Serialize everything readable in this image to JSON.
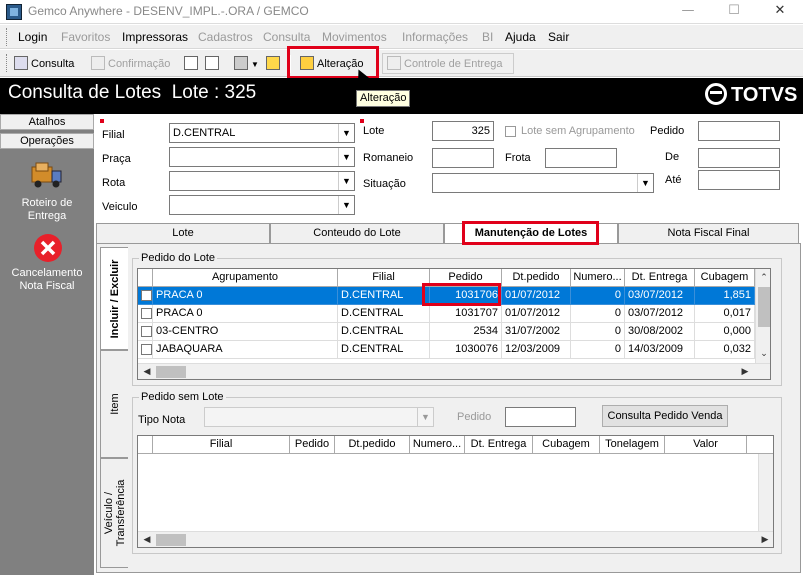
{
  "window": {
    "title": "Gemco Anywhere - DESENV_IMPL.-.ORA / GEMCO"
  },
  "menubar": {
    "items": [
      {
        "label": "Login",
        "enabled": true
      },
      {
        "label": "Favoritos",
        "enabled": false
      },
      {
        "label": "Impressoras",
        "enabled": true
      },
      {
        "label": "Cadastros",
        "enabled": false
      },
      {
        "label": "Consulta",
        "enabled": false
      },
      {
        "label": "Movimentos",
        "enabled": false
      },
      {
        "label": "Informações",
        "enabled": false
      },
      {
        "label": "BI",
        "enabled": false
      },
      {
        "label": "Ajuda",
        "enabled": true
      },
      {
        "label": "Sair",
        "enabled": true
      }
    ]
  },
  "toolbar": {
    "consulta": "Consulta",
    "confirmacao": "Confirmação",
    "alteracao": "Alteração",
    "controle_entrega": "Controle de Entrega"
  },
  "tooltip": "Alteração",
  "header": {
    "title": "Consulta de Lotes  Lote : 325",
    "brand": "TOTVS"
  },
  "sidebar": {
    "atalhos": "Atalhos",
    "operacoes": "Operações",
    "items": [
      {
        "label": "Roteiro de Entrega",
        "icon": "truck-icon"
      },
      {
        "label": "Cancelamento Nota Fiscal",
        "icon": "cancel-icon"
      }
    ]
  },
  "form": {
    "filial_label": "Filial",
    "filial_value": "D.CENTRAL",
    "praca_label": "Praça",
    "rota_label": "Rota",
    "veiculo_label": "Veiculo",
    "lote_label": "Lote",
    "lote_value": "325",
    "lote_sem_agrupamento": "Lote sem Agrupamento",
    "romaneio_label": "Romaneio",
    "frota_label": "Frota",
    "situacao_label": "Situação",
    "pedido_label": "Pedido",
    "de_label": "De",
    "ate_label": "Até"
  },
  "tabs": [
    "Lote",
    "Conteudo do Lote",
    "Manutenção de Lotes",
    "Nota Fiscal Final"
  ],
  "vtabs": [
    "Incluir / Excluir",
    "Item",
    "Veículo / Transferência"
  ],
  "pedido_lote": {
    "group_label": "Pedido do Lote",
    "columns": [
      "Agrupamento",
      "Filial",
      "Pedido",
      "Dt.pedido",
      "Numero...",
      "Dt. Entrega",
      "Cubagem"
    ],
    "rows": [
      [
        "PRACA 0",
        "D.CENTRAL",
        "1031706",
        "01/07/2012",
        "0",
        "03/07/2012",
        "1,851"
      ],
      [
        "PRACA 0",
        "D.CENTRAL",
        "1031707",
        "01/07/2012",
        "0",
        "03/07/2012",
        "0,017"
      ],
      [
        "03-CENTRO",
        "D.CENTRAL",
        "2534",
        "31/07/2002",
        "0",
        "30/08/2002",
        "0,000"
      ],
      [
        "JABAQUARA",
        "D.CENTRAL",
        "1030076",
        "12/03/2009",
        "0",
        "14/03/2009",
        "0,032"
      ]
    ]
  },
  "pedido_sem_lote": {
    "group_label": "Pedido sem Lote",
    "tipo_nota_label": "Tipo Nota",
    "pedido_label": "Pedido",
    "button": "Consulta Pedido Venda",
    "columns": [
      "Filial",
      "Pedido",
      "Dt.pedido",
      "Numero...",
      "Dt. Entrega",
      "Cubagem",
      "Tonelagem",
      "Valor"
    ]
  },
  "colors": {
    "accent_red": "#e0001a",
    "selection": "#0078d7",
    "header_bg": "#000000"
  }
}
